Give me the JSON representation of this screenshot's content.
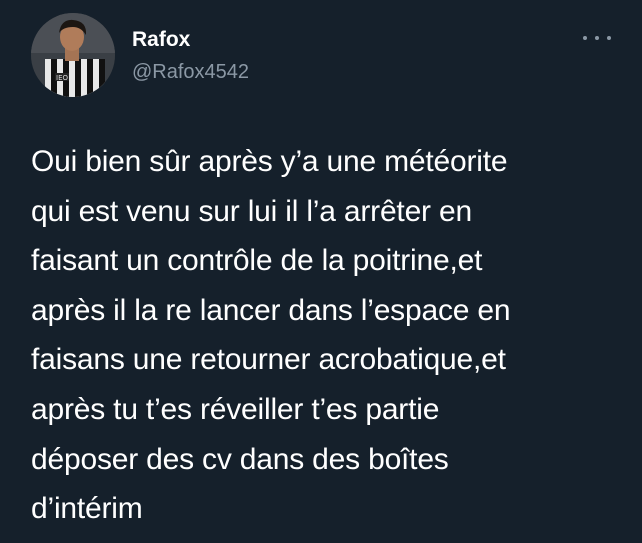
{
  "tweet": {
    "author": {
      "display_name": "Rafox",
      "handle": "@Rafox4542",
      "avatar_icon": "profile-photo-soccer-player"
    },
    "menu_icon": "more-options-icon",
    "text_lines": [
      "Oui bien sûr après y’a une météorite",
      "qui est venu sur lui il l’a arrêter en",
      "faisant un contrôle de la poitrine,et",
      "après il la re lancer dans l’espace en",
      "faisans une retourner acrobatique,et",
      "après tu t’es réveiller t’es partie",
      "déposer des cv dans des boîtes",
      "d’intérim"
    ],
    "colors": {
      "background": "#15202b",
      "primary_text": "#ffffff",
      "secondary_text": "#8b98a5"
    }
  }
}
